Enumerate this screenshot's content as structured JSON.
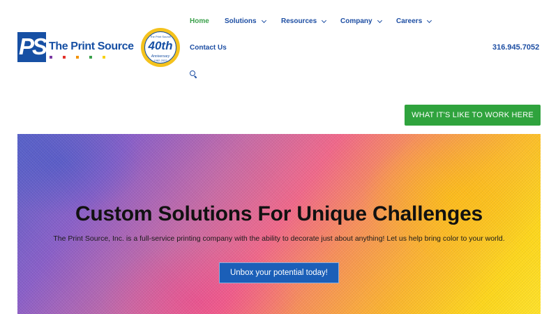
{
  "brand": {
    "logo_mark": "PS",
    "name": "The Print Source",
    "dot_colors": [
      "#7b3aa4",
      "#e2322b",
      "#f39200",
      "#3ca14c",
      "#f7d117"
    ]
  },
  "badge": {
    "top_text": "The Print Source",
    "number": "40th",
    "label": "Anniversary",
    "years": "1982-2022"
  },
  "nav": {
    "items": [
      {
        "label": "Home",
        "active": true
      },
      {
        "label": "Solutions",
        "dropdown": true
      },
      {
        "label": "Resources",
        "dropdown": true
      },
      {
        "label": "Company",
        "dropdown": true
      },
      {
        "label": "Careers",
        "dropdown": true
      },
      {
        "label": "Contact Us"
      }
    ],
    "search_icon": "search-icon"
  },
  "header": {
    "phone": "316.945.7052"
  },
  "cta": {
    "work_button": "WHAT IT'S LIKE TO WORK HERE"
  },
  "hero": {
    "title": "Custom Solutions For Unique Challenges",
    "subtitle": "The Print Source, Inc. is a full-service printing company with the ability to decorate just about anything! Let us help bring color to your world.",
    "button": "Unbox your potential today!"
  },
  "colors": {
    "brand_blue": "#1750a4",
    "nav_blue": "#1d4ea3",
    "active_green": "#3ca14c",
    "cta_green": "#2fa33d",
    "hero_button_blue": "#1b5fb8"
  }
}
